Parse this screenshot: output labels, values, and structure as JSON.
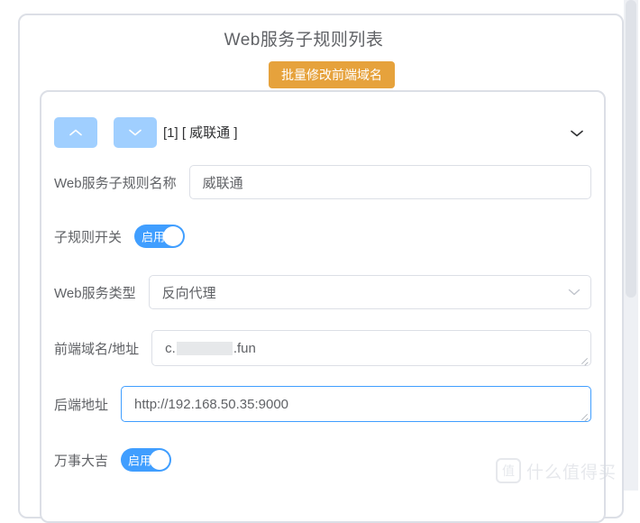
{
  "page": {
    "title": "Web服务子规则列表"
  },
  "toolbar": {
    "bulk_edit_label": "批量修改前端域名"
  },
  "rule_card": {
    "header": {
      "move_up_icon": "chevron-up-icon",
      "move_down_icon": "chevron-down-icon",
      "title": "[1] [ 威联通 ]",
      "collapse_icon": "chevron-down-icon"
    },
    "fields": {
      "name": {
        "label": "Web服务子规则名称",
        "value": "威联通"
      },
      "switch": {
        "label": "子规则开关",
        "state_label": "启用"
      },
      "service_type": {
        "label": "Web服务类型",
        "value": "反向代理",
        "caret_icon": "chevron-down-icon"
      },
      "frontend": {
        "label": "前端域名/地址",
        "value_prefix": "c.",
        "value_suffix": ".fun"
      },
      "backend": {
        "label": "后端地址",
        "value": "http://192.168.50.35:9000"
      },
      "extra_switch": {
        "label": "万事大吉",
        "state_label": "启用"
      }
    }
  },
  "watermark": {
    "mark": "值",
    "text": "什么值得买"
  },
  "colors": {
    "accent_blue": "#409eff",
    "light_blue": "#a0cfff",
    "warning_orange": "#e6a23c",
    "border_gray": "#dcdfe6",
    "text_gray": "#606266"
  }
}
